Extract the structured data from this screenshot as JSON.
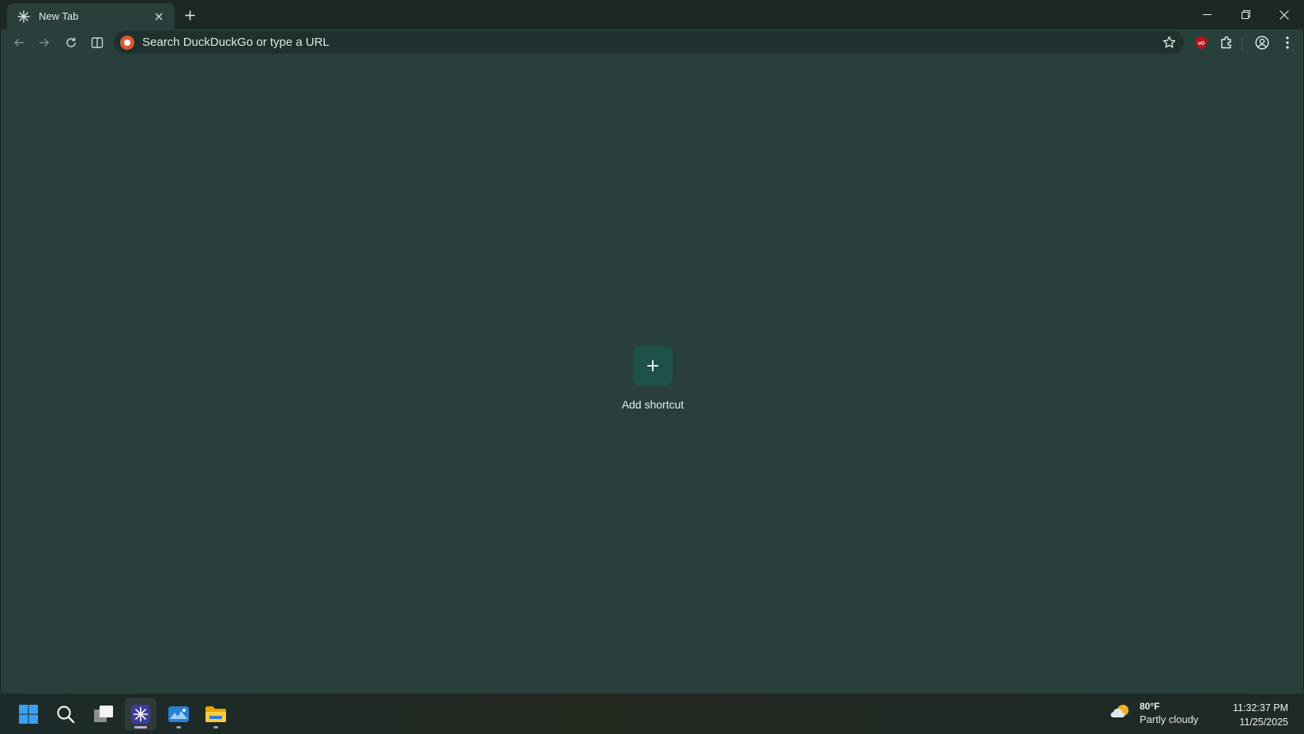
{
  "browser": {
    "tab": {
      "title": "New Tab",
      "favicon": "browser-asterisk-icon"
    },
    "new_tab_icon": "plus-icon",
    "window_controls": [
      "minimize-icon",
      "restore-icon",
      "close-icon"
    ],
    "toolbar": {
      "buttons": [
        "back-arrow-icon",
        "forward-arrow-icon",
        "reload-icon",
        "split-view-icon"
      ],
      "omnibox": {
        "placeholder": "Search DuckDuckGo or type a URL",
        "value": ""
      },
      "right_icons": [
        "bookmark-star-icon",
        "ublock-origin-icon",
        "extensions-puzzle-icon",
        "profile-icon",
        "menu-kebab-icon"
      ]
    },
    "new_tab_page": {
      "shortcut": {
        "label": "Add shortcut",
        "icon": "plus-icon"
      }
    }
  },
  "taskbar": {
    "apps": [
      "windows-start-icon",
      "search-icon",
      "task-view-icon",
      "browser-icon",
      "photos-icon",
      "file-explorer-icon"
    ],
    "weather": {
      "temperature": "80°F",
      "condition": "Partly cloudy",
      "icon": "partly-cloudy-icon"
    },
    "clock": {
      "time": "11:32:37 PM",
      "date": "11/25/2025"
    }
  },
  "colors": {
    "page_bg": "#283f3c",
    "tabstrip_bg": "#1b2826",
    "omnibox_bg": "#1f302e",
    "shortcut_tile": "#1e5148",
    "ddg_orange": "#de5833",
    "ublock_red": "#b5161d"
  }
}
